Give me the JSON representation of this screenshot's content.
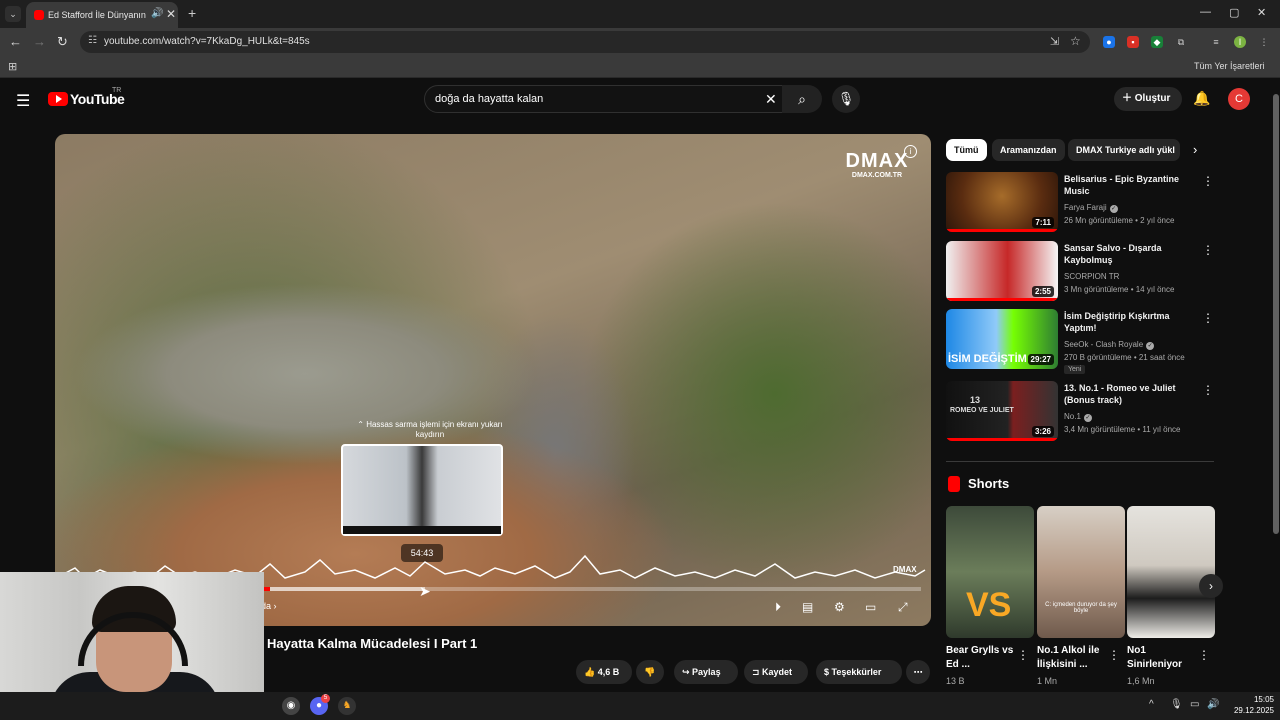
{
  "browser": {
    "tab_title": "Ed Stafford İle Dünyanın En",
    "tab_close": "✕",
    "new_tab": "+",
    "url": "youtube.com/watch?v=7KkaDg_HULk&t=845s",
    "bookmarks_label": "Tüm Yer İşaretleri"
  },
  "youtube": {
    "logo_text": "YouTube",
    "region": "TR",
    "search_query": "doğa da hayatta kalan",
    "create_label": "Oluştur",
    "avatar_letter": "C"
  },
  "player": {
    "watermark_big": "DMAX",
    "watermark_small": "DMAX.COM.TR",
    "fine_seek_hint": "⌃ Hassas sarma işlemi için ekranı yukarı kaydırın",
    "preview_time": "54:43",
    "chapter_label": "da",
    "progress_played": 0.24,
    "progress_hover": 0.42,
    "corner_logo": "DMAX"
  },
  "video": {
    "title": "Hayatta Kalma Mücadelesi I Part 1",
    "likes": "4,6 B",
    "share_label": "Paylaş",
    "save_label": "Kaydet",
    "thanks_label": "Teşekkürler"
  },
  "chips": [
    "Tümü",
    "Aramanızdan",
    "DMAX Turkiye adlı yükl"
  ],
  "related": [
    {
      "title": "Belisarius - Epic Byzantine Music",
      "channel": "Farya Faraji",
      "verified": true,
      "meta": "26 Mn görüntüleme • 2 yıl önce",
      "duration": "7:11",
      "badge": ""
    },
    {
      "title": "Sansar Salvo - Dışarda Kaybolmuş",
      "channel": "SCORPION TR",
      "verified": false,
      "meta": "3 Mn görüntüleme • 14 yıl önce",
      "duration": "2:55",
      "badge": ""
    },
    {
      "title": "İsim Değiştirip Kışkırtma Yaptım!",
      "channel": "SeeOk - Clash Royale",
      "verified": true,
      "meta": "270 B görüntüleme • 21 saat önce",
      "duration": "29:27",
      "badge": "Yeni"
    },
    {
      "title": "13. No.1 - Romeo ve Juliet (Bonus track)",
      "channel": "No.1",
      "verified": true,
      "meta": "3,4 Mn görüntüleme • 11 yıl önce",
      "duration": "3:26",
      "badge": ""
    }
  ],
  "thumb_texts": {
    "r3": "İSİM DEĞİŞTİM",
    "r4a": "13",
    "r4b": "ROMEO VE JULIET"
  },
  "shorts": {
    "heading": "Shorts",
    "items": [
      {
        "title": "Bear Grylls vs Ed ...",
        "views": "13 B",
        "overlay": "VS"
      },
      {
        "title": "No.1 Alkol ile İlişkisini ...",
        "views": "1 Mn",
        "overlay": "C: içmeden duruyor da şey böyle"
      },
      {
        "title": "No1 Sinirleniyor",
        "views": "1,6 Mn",
        "overlay": ""
      }
    ]
  },
  "taskbar": {
    "time": "15:05",
    "date": "29.12.2025",
    "discord_badge": "5"
  }
}
